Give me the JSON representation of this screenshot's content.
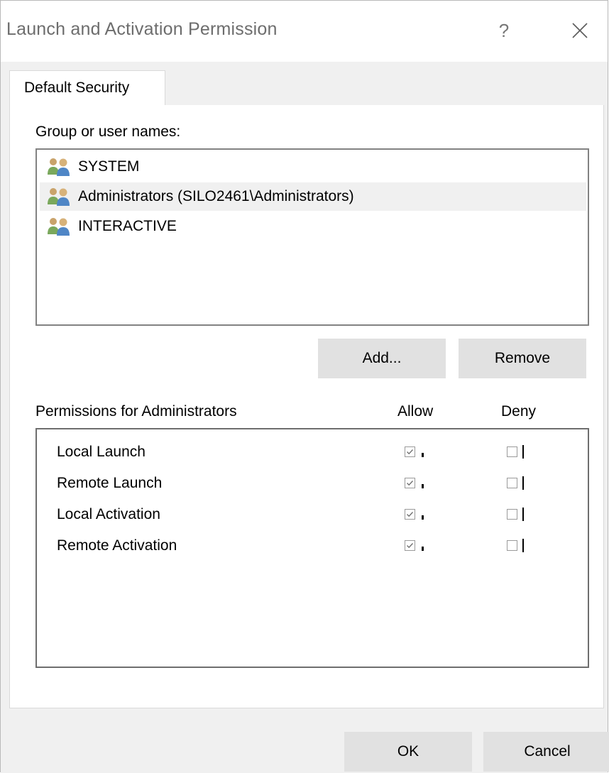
{
  "window": {
    "title": "Launch and Activation Permission",
    "help_label": "?"
  },
  "tabs": [
    {
      "label": "Default Security",
      "selected": true
    }
  ],
  "groups": {
    "heading": "Group or user names:",
    "items": [
      {
        "label": "SYSTEM",
        "icon": "users-icon",
        "selected": false
      },
      {
        "label": "Administrators (SILO2461\\Administrators)",
        "icon": "users-icon",
        "selected": true
      },
      {
        "label": "INTERACTIVE",
        "icon": "users-icon",
        "selected": false
      }
    ]
  },
  "group_buttons": {
    "add_label": "Add...",
    "remove_label": "Remove"
  },
  "permissions": {
    "heading": "Permissions for Administrators",
    "allow_header": "Allow",
    "deny_header": "Deny",
    "rows": [
      {
        "name": "Local Launch",
        "allow": true,
        "deny": false
      },
      {
        "name": "Remote Launch",
        "allow": true,
        "deny": false
      },
      {
        "name": "Local Activation",
        "allow": true,
        "deny": false
      },
      {
        "name": "Remote Activation",
        "allow": true,
        "deny": false
      }
    ]
  },
  "footer": {
    "ok_label": "OK",
    "cancel_label": "Cancel"
  },
  "colors": {
    "panel_bg": "#f0f0f0",
    "button_bg": "#e1e1e1",
    "selection_bg": "#f0f0f0",
    "title_text": "#6d6d6d"
  }
}
